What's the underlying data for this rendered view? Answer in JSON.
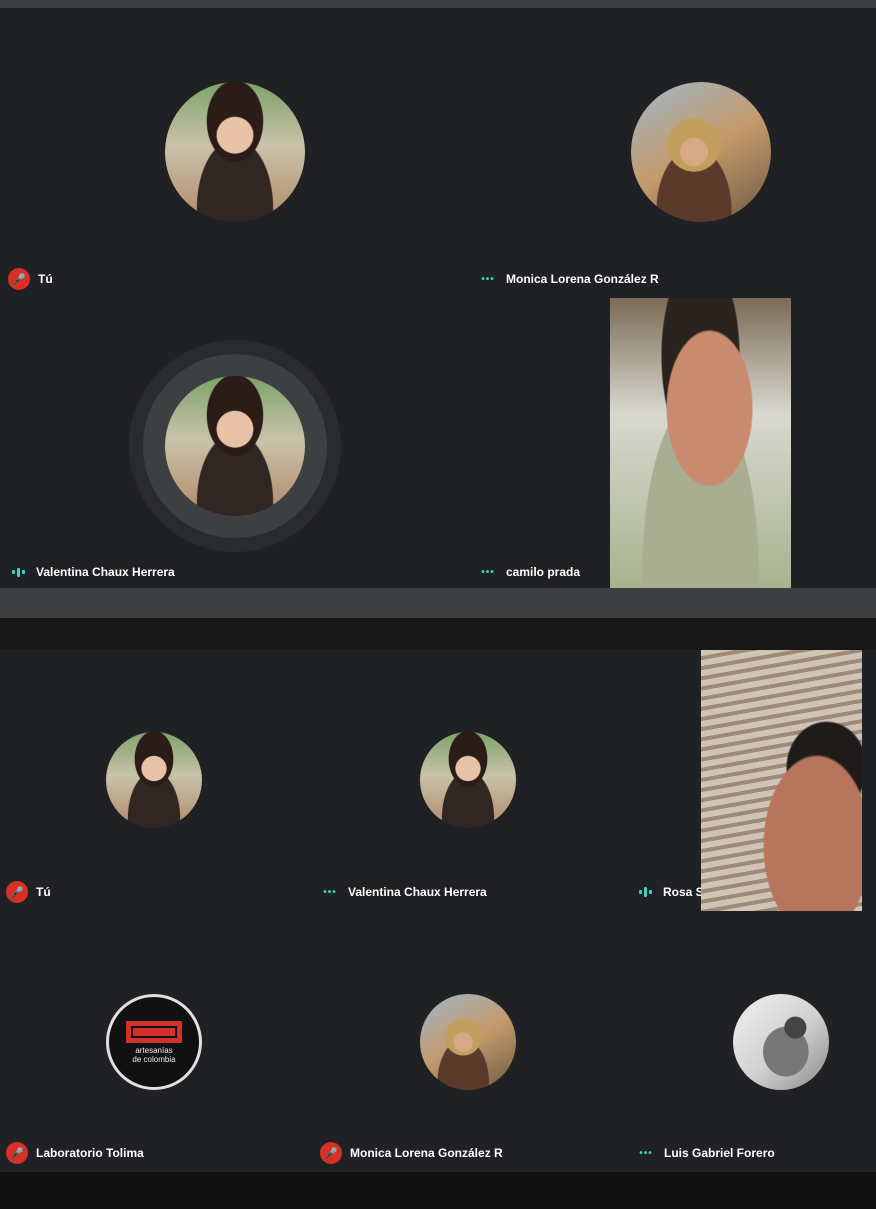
{
  "top_panel": {
    "tiles": [
      {
        "name": "Tú",
        "status": "muted"
      },
      {
        "name": "Monica Lorena González R",
        "status": "idle"
      },
      {
        "name": "Valentina Chaux Herrera",
        "status": "speaking"
      },
      {
        "name": "camilo prada",
        "status": "idle"
      }
    ]
  },
  "bottom_panel": {
    "tiles": [
      {
        "name": "Tú",
        "status": "muted"
      },
      {
        "name": "Valentina Chaux Herrera",
        "status": "idle"
      },
      {
        "name": "Rosa Salazar",
        "status": "speaking"
      },
      {
        "name": "Laboratorio Tolima",
        "status": "muted"
      },
      {
        "name": "Monica Lorena González R",
        "status": "muted"
      },
      {
        "name": "Luis Gabriel Forero",
        "status": "idle"
      }
    ],
    "logo_text": [
      "artesanías",
      "de colombia"
    ]
  },
  "icons": {
    "muted": "mic-off-icon",
    "idle": "more-dots-icon",
    "speaking": "audio-level-icon"
  },
  "colors": {
    "background": "#202124",
    "muted": "#d93025",
    "accent": "#3fd2c2"
  }
}
